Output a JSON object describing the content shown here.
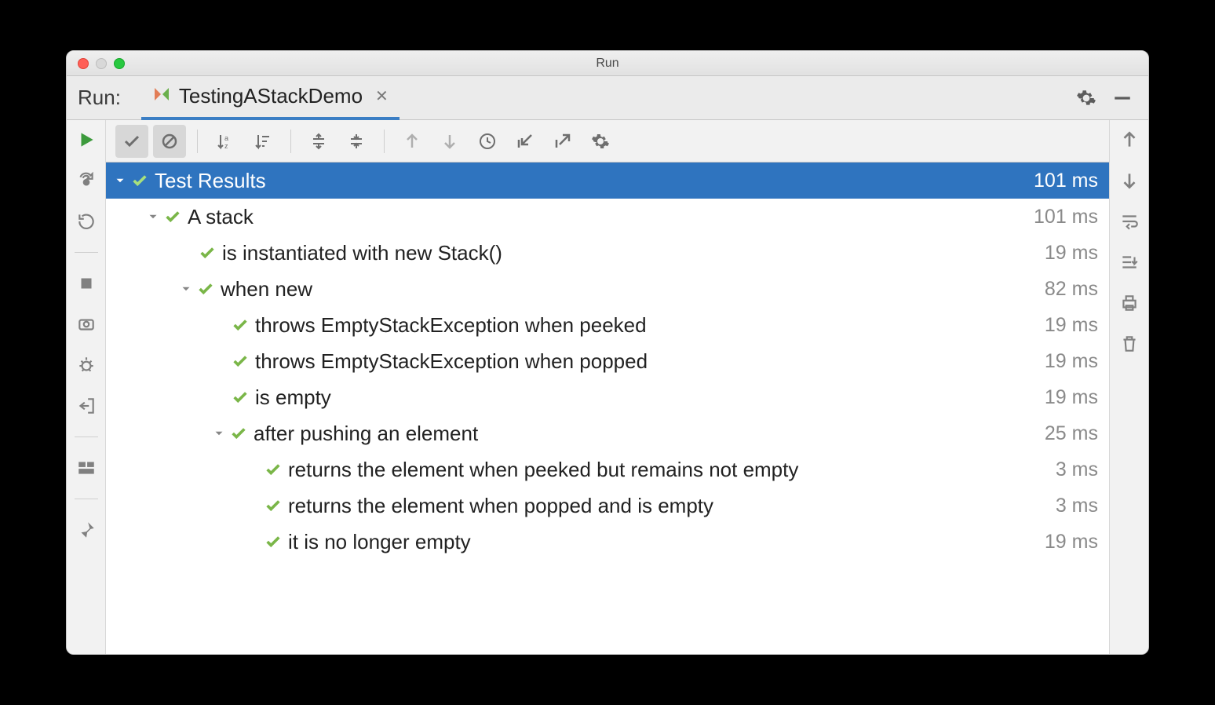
{
  "window": {
    "title": "Run"
  },
  "tabbar": {
    "run_label": "Run:",
    "tab_name": "TestingAStackDemo"
  },
  "tree": {
    "root": {
      "label": "Test Results",
      "time": "101 ms"
    },
    "n1": {
      "label": "A stack",
      "time": "101 ms"
    },
    "n1_1": {
      "label": "is instantiated with new Stack()",
      "time": "19 ms"
    },
    "n1_2": {
      "label": "when new",
      "time": "82 ms"
    },
    "n1_2_1": {
      "label": "throws EmptyStackException when peeked",
      "time": "19 ms"
    },
    "n1_2_2": {
      "label": "throws EmptyStackException when popped",
      "time": "19 ms"
    },
    "n1_2_3": {
      "label": "is empty",
      "time": "19 ms"
    },
    "n1_3": {
      "label": "after pushing an element",
      "time": "25 ms"
    },
    "n1_3_1": {
      "label": "returns the element when peeked but remains not empty",
      "time": "3 ms"
    },
    "n1_3_2": {
      "label": "returns the element when popped and is empty",
      "time": "3 ms"
    },
    "n1_3_3": {
      "label": "it is no longer empty",
      "time": "19 ms"
    }
  }
}
